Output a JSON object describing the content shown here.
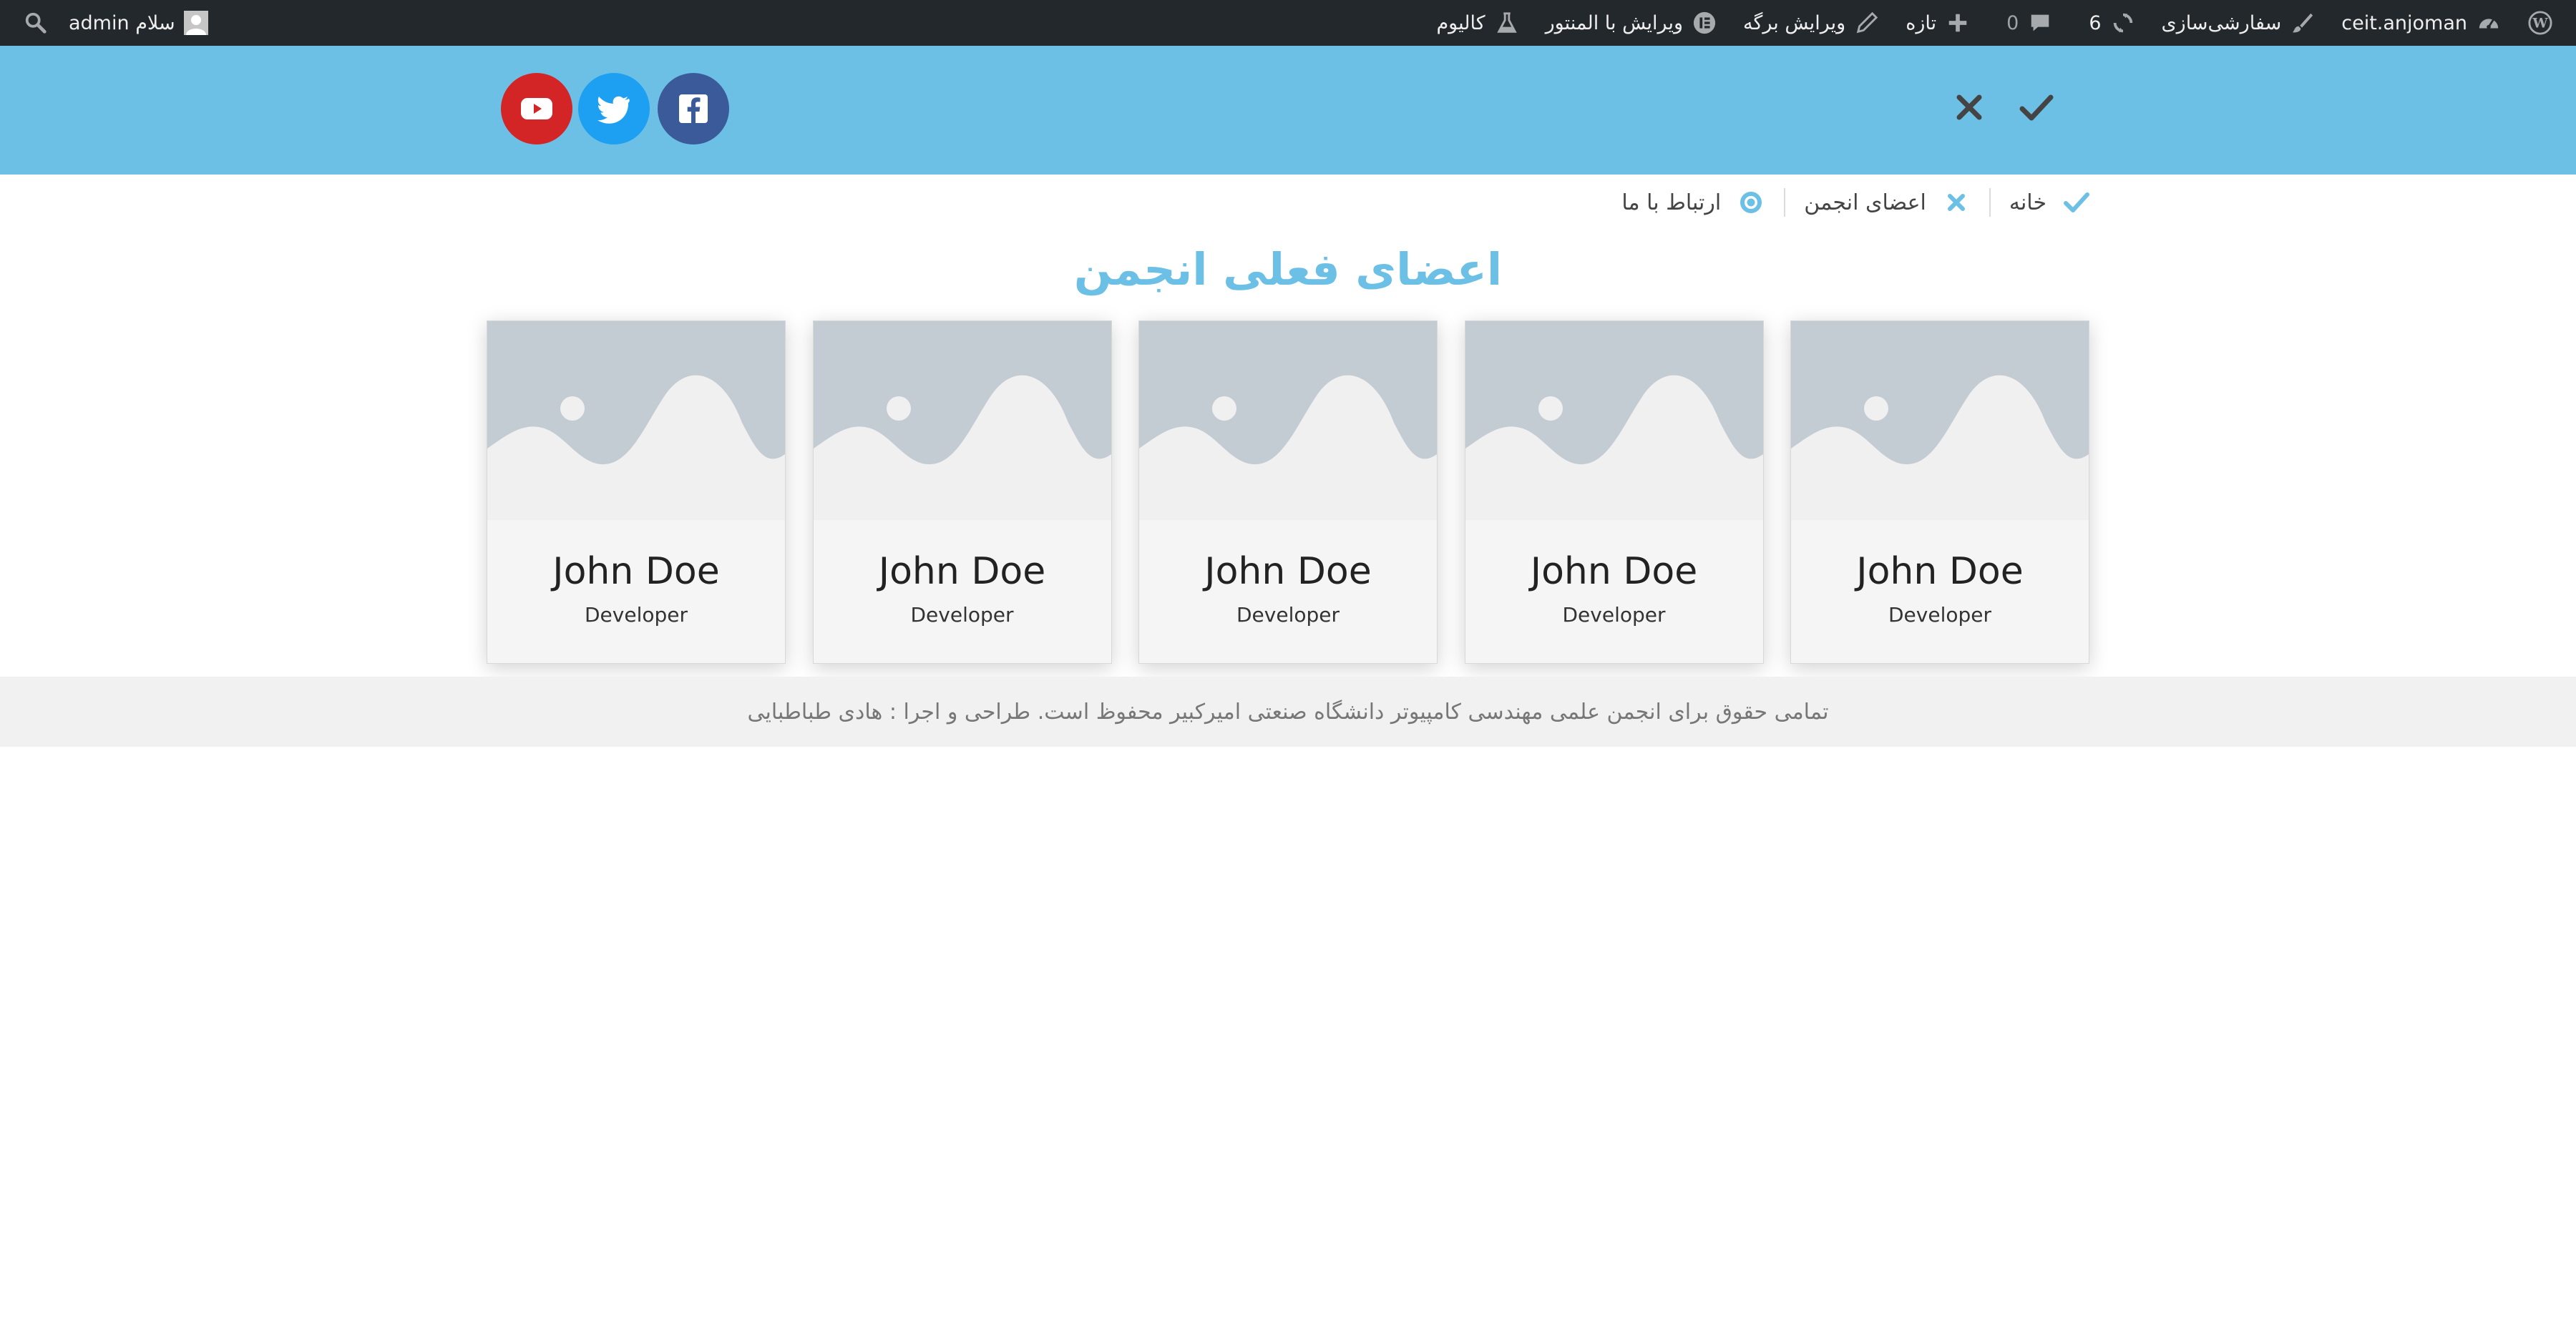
{
  "adminbar": {
    "site_name": "ceit.anjoman",
    "customize": "سفارشی‌سازی",
    "updates_count": "6",
    "comments_count": "0",
    "new_label": "تازه",
    "edit_page": "ویرایش برگه",
    "edit_elementor": "ویرایش با المنتور",
    "calium": "کالیوم",
    "greeting": "سلام admin",
    "bg_color": "#23282d"
  },
  "header": {
    "bg_color": "#6dc0e5",
    "social": [
      {
        "name": "youtube",
        "icon": "youtube-icon",
        "color": "#d32526"
      },
      {
        "name": "twitter",
        "icon": "twitter-icon",
        "color": "#1da0f2"
      },
      {
        "name": "facebook",
        "icon": "facebook-icon",
        "color": "#3b5a9a"
      }
    ]
  },
  "menu": {
    "items": [
      {
        "label": "خانه",
        "icon": "check-icon"
      },
      {
        "label": "اعضای انجمن",
        "icon": "close-icon"
      },
      {
        "label": "ارتباط با ما",
        "icon": "circle-dot-icon"
      }
    ]
  },
  "main": {
    "title": "اعضای فعلی انجمن",
    "title_color": "#6dc0e5",
    "members": [
      {
        "name": "John Doe",
        "role": "Developer"
      },
      {
        "name": "John Doe",
        "role": "Developer"
      },
      {
        "name": "John Doe",
        "role": "Developer"
      },
      {
        "name": "John Doe",
        "role": "Developer"
      },
      {
        "name": "John Doe",
        "role": "Developer"
      }
    ]
  },
  "footer": {
    "text": "تمامی حقوق برای انجمن علمی مهندسی کامپیوتر دانشگاه صنعتی امیرکبیر محفوظ است. طراحی و اجرا : هادی طباطبایی"
  }
}
